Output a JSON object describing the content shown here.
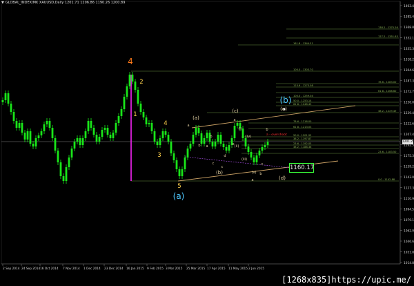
{
  "header": {
    "symbol_line": "GLOBAL_INDEX/MK  XAUUSD,Daily  1201.71 1206.86 1190.26 1200.89"
  },
  "watermark": "[1268x835]https://upic.me/",
  "current_price_tag": "1201.29",
  "target_box_label": "1160.17",
  "colors": {
    "background": "#000000",
    "bull_candle": "#19e619",
    "bear_candle": "#19e619",
    "fib_line": "#6b8f3e",
    "channel": "#c9a064",
    "magenta_line": "#e020e0",
    "wave_orange": "#ff7a1a",
    "wave_gold": "#ffd24d",
    "wave_cyan": "#4cc8ff",
    "sub_wave": "#e8d6a8",
    "dot_purple": "#9c4ad6",
    "overshoot_red": "#ff3030"
  },
  "wave_labels": [
    {
      "text": "4",
      "color": "orange",
      "size": "big"
    },
    {
      "text": "2",
      "color": "gold",
      "size": "mid"
    },
    {
      "text": "1",
      "color": "gold",
      "size": "mid"
    },
    {
      "text": "4",
      "color": "gold",
      "size": "mid"
    },
    {
      "text": "3",
      "color": "gold",
      "size": "mid"
    },
    {
      "text": "5",
      "color": "gold",
      "size": "mid"
    },
    {
      "text": "(a)",
      "color": "cyan",
      "size": "big"
    },
    {
      "text": "(b)",
      "color": "cyan",
      "size": "big"
    },
    {
      "text": "(a)",
      "color": "sub",
      "size": "small"
    },
    {
      "text": "(b)",
      "color": "sub",
      "size": "small"
    },
    {
      "text": "(c)",
      "color": "sub",
      "size": "small"
    },
    {
      "text": "(d)",
      "color": "sub",
      "size": "small"
    },
    {
      "text": "(e)",
      "color": "sub",
      "size": "small"
    },
    {
      "text": "(i)",
      "color": "sub",
      "size": "tiny"
    },
    {
      "text": "(ii)",
      "color": "sub",
      "size": "tiny"
    },
    {
      "text": "(iii)",
      "color": "sub",
      "size": "tiny"
    },
    {
      "text": "(iv)",
      "color": "sub",
      "size": "tiny"
    },
    {
      "text": "(v)",
      "color": "sub",
      "size": "tiny"
    },
    {
      "text": "a",
      "color": "sub",
      "size": "tiny"
    },
    {
      "text": "b",
      "color": "sub",
      "size": "tiny"
    },
    {
      "text": "c",
      "color": "sub",
      "size": "tiny"
    },
    {
      "text": "d",
      "color": "sub",
      "size": "tiny"
    },
    {
      "text": "e",
      "color": "sub",
      "size": "tiny"
    },
    {
      "text": "a",
      "color": "sub",
      "size": "tiny"
    },
    {
      "text": "b",
      "color": "sub",
      "size": "tiny"
    },
    {
      "text": "c",
      "color": "sub",
      "size": "tiny"
    },
    {
      "text": "a",
      "color": "sub",
      "size": "tiny"
    },
    {
      "text": "b",
      "color": "sub",
      "size": "tiny"
    },
    {
      "text": "a",
      "color": "sub",
      "size": "tiny"
    },
    {
      "text": "b",
      "color": "sub",
      "size": "tiny"
    },
    {
      "text": "c",
      "color": "sub",
      "size": "tiny"
    }
  ],
  "overshoot_label": "a - overshoot",
  "fib_labels": [
    "138.2 - 1375.26",
    "127.2 - 1351.63",
    "161.8 - 1344.51",
    "100.0 - 1303.70",
    "78.6 - 1283.00",
    "123.6 - 1273.08",
    "61.8 - 1268.60",
    "100.0 - 1259.04",
    "50.0 - 1253.14",
    "61.8 - 1248.43",
    "38.2 - 1229.49",
    "78.6 - 1218.00",
    "61.8 - 1213.03",
    "50.0 - 1201.95",
    "38.2 - 1197.87",
    "23.6 - 1192.05",
    "38.2 - 1188.36",
    "23.6 - 1183.50",
    "0.0 - 1142.88"
  ],
  "price_axis": [
    "1403.49",
    "1385.46",
    "1368.84",
    "1352.13",
    "1335.34",
    "1318.29",
    "1304.65",
    "1287.35",
    "1272.72",
    "1256.09",
    "1239.41",
    "1222.63",
    "1207.44",
    "1192.58",
    "1175.36",
    "1159.27",
    "1143.08",
    "1127.35",
    "1110.96",
    "1094.53",
    "1079.19",
    "1062.99",
    "1046.62",
    "1031.84",
    "1014.89"
  ],
  "date_axis": [
    "2 Sep 2014",
    "24 Sep 2014",
    "16 Oct 2014",
    "7 Nov 2014",
    "1 Dec 2014",
    "23 Dec 2014",
    "16 Jan 2015",
    "9 Feb 2015",
    "3 Mar 2015",
    "25 Mar 2015",
    "17 Apr 2015",
    "11 May 2015",
    "2 Jun 2015"
  ]
}
